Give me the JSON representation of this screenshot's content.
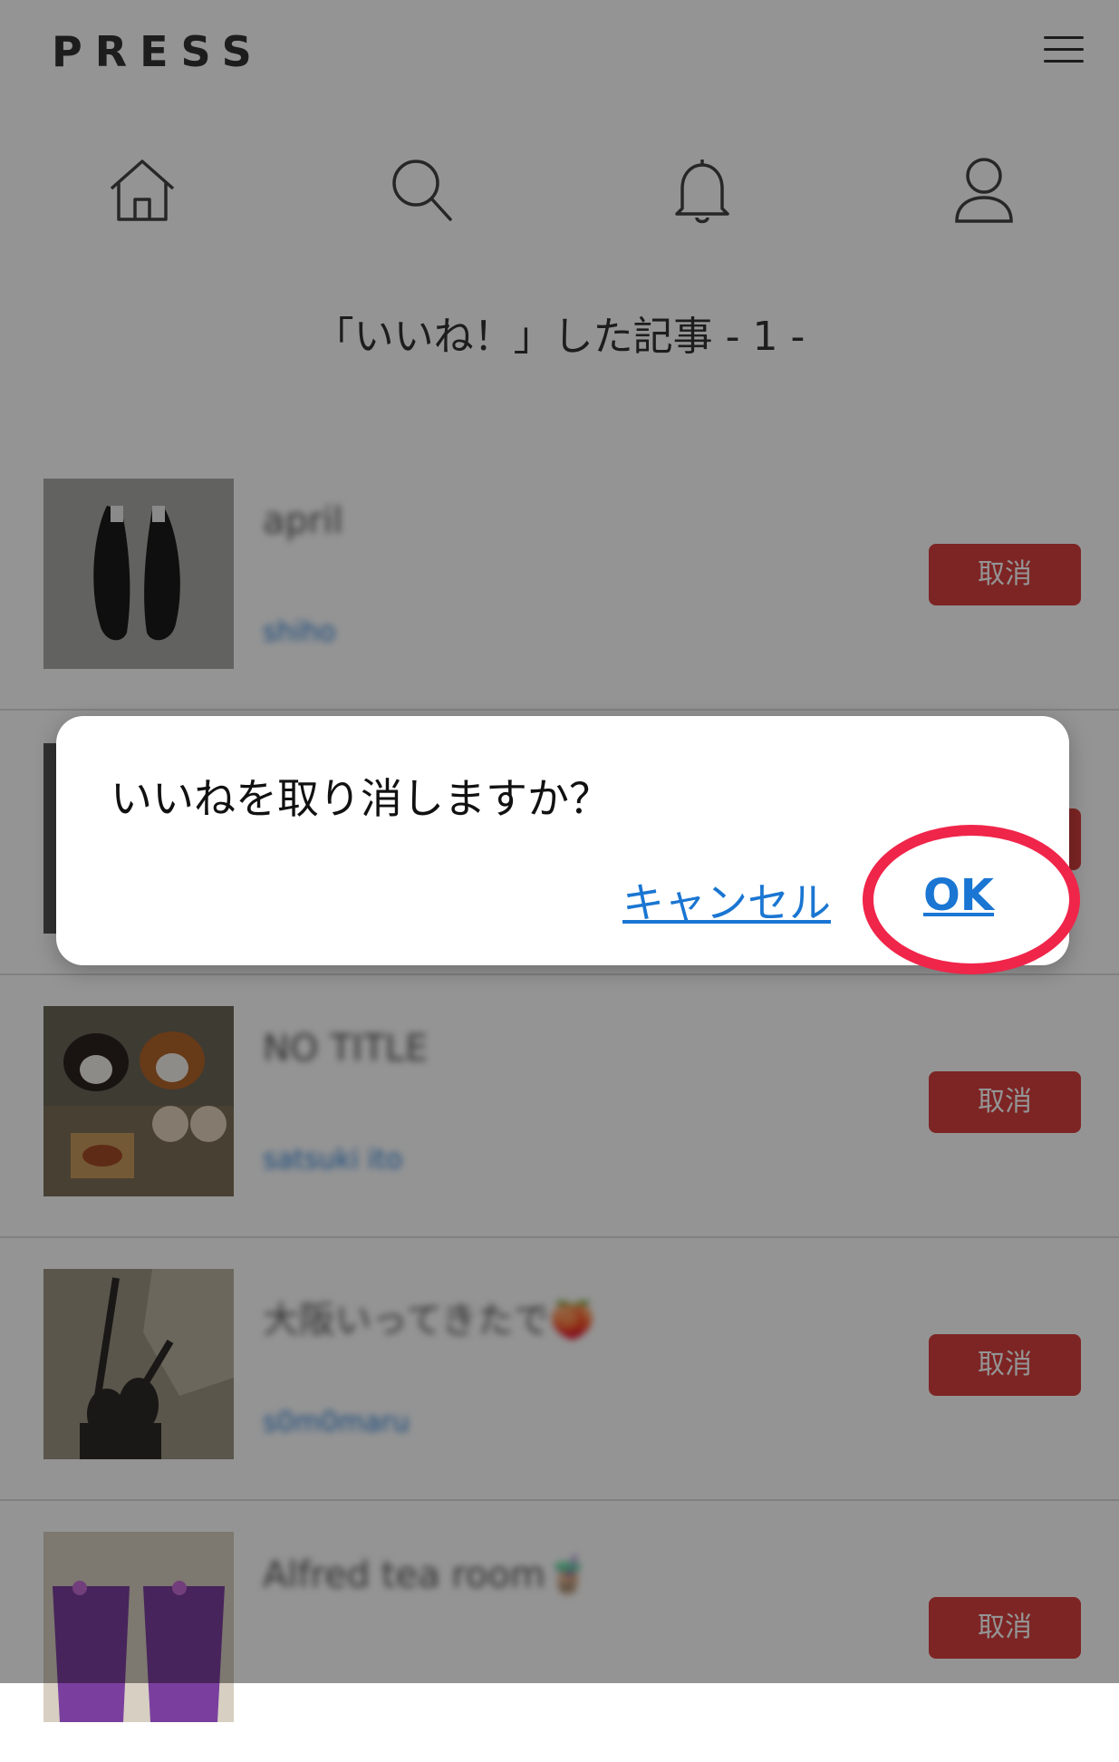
{
  "header": {
    "logo": "PRESS"
  },
  "nav": [
    {
      "icon": "home-icon"
    },
    {
      "icon": "search-icon"
    },
    {
      "icon": "bell-icon"
    },
    {
      "icon": "user-icon"
    }
  ],
  "page_title": "「いいね！」した記事 - 1 -",
  "items": [
    {
      "title": "april",
      "author": "shiho",
      "button": "取消"
    },
    {
      "title": "",
      "author": "",
      "button": "取消"
    },
    {
      "title": "NO TITLE",
      "author": "satsuki ito",
      "button": "取消"
    },
    {
      "title": "大阪いってきたで🍑",
      "author": "s0m0maru",
      "button": "取消"
    },
    {
      "title": "Alfred tea room🧋",
      "author": "",
      "button": "取消"
    }
  ],
  "dialog": {
    "message": "いいねを取り消しますか？",
    "cancel_label": "キャンセル",
    "ok_label": "OK"
  },
  "colors": {
    "cancel_button": "#d8403f",
    "link": "#1a76d2",
    "highlight": "#f0254a"
  }
}
